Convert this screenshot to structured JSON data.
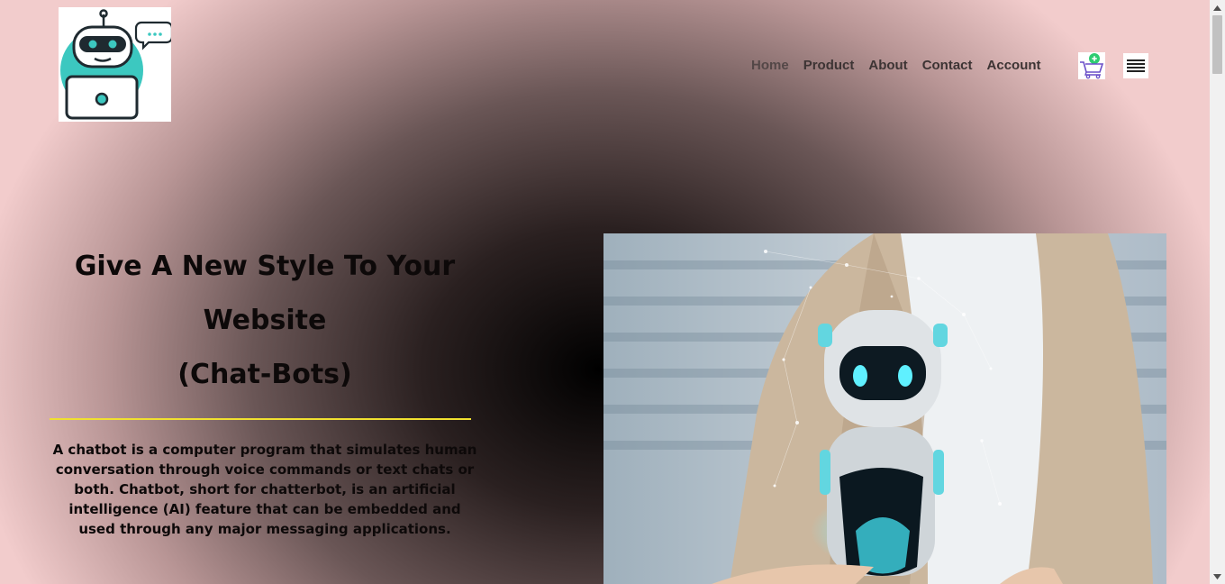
{
  "nav": {
    "items": [
      "Home",
      "Product",
      "About",
      "Contact",
      "Account"
    ]
  },
  "logo": {
    "icon": "robot-laptop-logo"
  },
  "cart": {
    "icon": "shopping-cart-icon"
  },
  "menu": {
    "icon": "hamburger-menu-icon"
  },
  "hero": {
    "title_line1": "Give A New Style To Your",
    "title_line2": "Website",
    "title_line3": "(Chat-Bots)",
    "description": "A chatbot is a computer program that simulates human conversation through voice commands or text chats or both. Chatbot, short for chatterbot, is an artificial intelligence (AI) feature that can be embedded and used through any major messaging applications.",
    "image": "robot-hologram-hand"
  },
  "colors": {
    "divider": "#f0e030",
    "accent": "#3cc8c0",
    "edge_pink": "#f2cccc"
  }
}
